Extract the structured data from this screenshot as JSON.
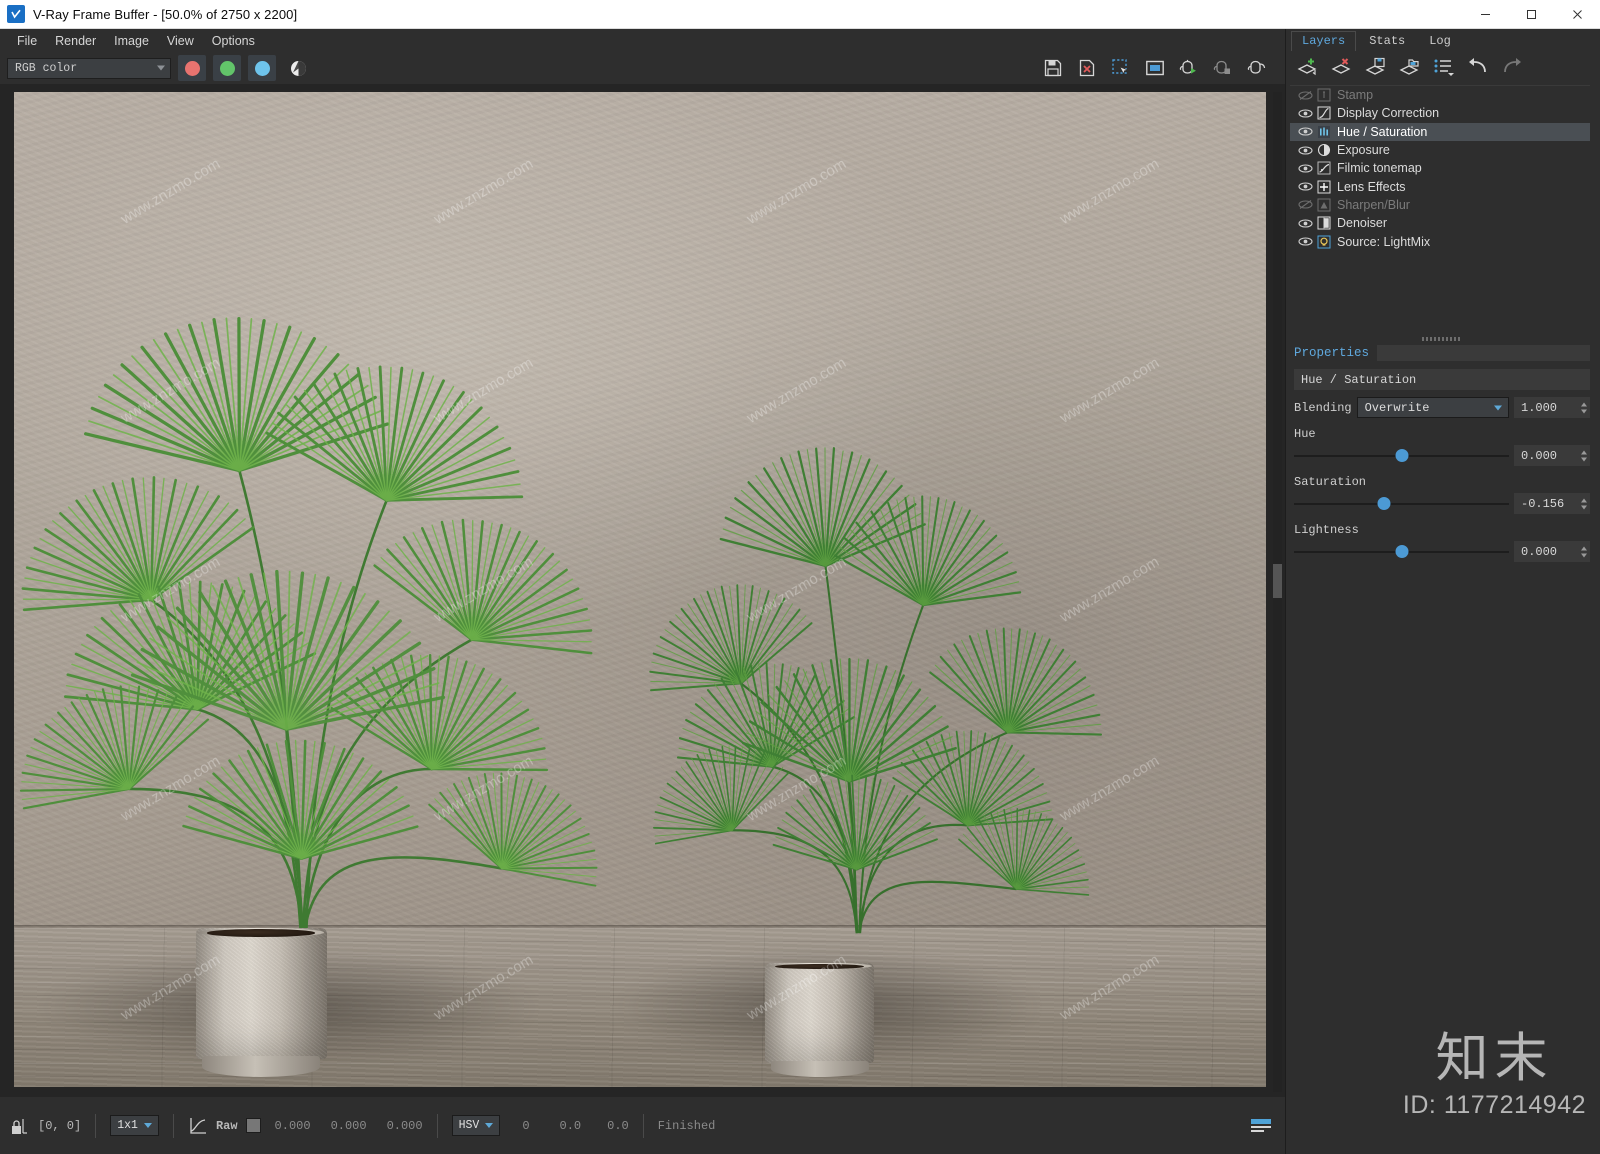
{
  "window": {
    "title": "V-Ray Frame Buffer - [50.0% of 2750 x 2200]",
    "icon": "vray-logo-icon",
    "minimize_label": "—",
    "maximize_label": "□",
    "close_label": "✕"
  },
  "menu": {
    "items": [
      {
        "label": "File"
      },
      {
        "label": "Render"
      },
      {
        "label": "Image"
      },
      {
        "label": "View"
      },
      {
        "label": "Options"
      }
    ]
  },
  "toolbar": {
    "channel_select": {
      "value": "RGB color",
      "icon": "chevron-down-icon"
    },
    "color_buttons": [
      {
        "name": "red-channel-button",
        "color": "#e8736f"
      },
      {
        "name": "green-channel-button",
        "color": "#62c46a"
      },
      {
        "name": "blue-channel-button",
        "color": "#6ec4ec"
      }
    ],
    "alpha_button": {
      "name": "alpha-channel-button",
      "color": "#e9e9e9"
    },
    "right_tools": [
      {
        "name": "save-image-button",
        "icon": "save-icon"
      },
      {
        "name": "clear-image-button",
        "icon": "file-delete-icon"
      },
      {
        "name": "region-render-button",
        "icon": "region-select-icon"
      },
      {
        "name": "fit-to-window-button",
        "icon": "fit-window-icon"
      },
      {
        "name": "start-render-button",
        "icon": "teapot-play-icon"
      },
      {
        "name": "stop-render-button",
        "icon": "teapot-stop-icon"
      },
      {
        "name": "resume-render-button",
        "icon": "teapot-resume-icon"
      }
    ]
  },
  "statusbar": {
    "pixel_lock_icon": "pixel-lock-icon",
    "coords": "[0,  0]",
    "sample_size": {
      "value": "1x1",
      "icon": "chevron-down-icon"
    },
    "curve_icon": "curve-icon",
    "raw_label": "Raw",
    "color_swatch": "#777777",
    "rgb_values": [
      "0.000",
      "0.000",
      "0.000"
    ],
    "color_mode": {
      "value": "HSV",
      "icon": "chevron-down-icon"
    },
    "hsv_values": [
      "0",
      "0.0",
      "0.0"
    ],
    "render_status": "Finished",
    "histogram_icon": "histogram-icon"
  },
  "right_panel": {
    "tabs": [
      {
        "label": "Layers",
        "active": true
      },
      {
        "label": "Stats",
        "active": false
      },
      {
        "label": "Log",
        "active": false
      }
    ],
    "layer_toolbar": [
      {
        "name": "add-layer-button",
        "icon": "layer-add-icon"
      },
      {
        "name": "delete-layer-button",
        "icon": "layer-delete-icon"
      },
      {
        "name": "save-layers-button",
        "icon": "layer-save-icon"
      },
      {
        "name": "load-layers-button",
        "icon": "layer-load-icon"
      },
      {
        "name": "layer-presets-button",
        "icon": "list-menu-icon"
      },
      {
        "name": "undo-button",
        "icon": "undo-icon"
      },
      {
        "name": "redo-button",
        "icon": "redo-icon"
      }
    ],
    "layers": [
      {
        "name": "Stamp",
        "icon": "stamp-icon",
        "visible": false,
        "enabled": false,
        "selected": false
      },
      {
        "name": "Display Correction",
        "icon": "curve-icon",
        "visible": true,
        "enabled": true,
        "selected": false
      },
      {
        "name": "Hue / Saturation",
        "icon": "hue-saturation-icon",
        "visible": true,
        "enabled": true,
        "selected": true
      },
      {
        "name": "Exposure",
        "icon": "exposure-icon",
        "visible": true,
        "enabled": true,
        "selected": false
      },
      {
        "name": "Filmic tonemap",
        "icon": "filmic-tonemap-icon",
        "visible": true,
        "enabled": true,
        "selected": false
      },
      {
        "name": "Lens Effects",
        "icon": "lens-effects-icon",
        "visible": true,
        "enabled": true,
        "selected": false
      },
      {
        "name": "Sharpen/Blur",
        "icon": "sharpen-blur-icon",
        "visible": false,
        "enabled": false,
        "selected": false
      },
      {
        "name": "Denoiser",
        "icon": "denoiser-icon",
        "visible": true,
        "enabled": true,
        "selected": false
      },
      {
        "name": "Source: LightMix",
        "icon": "lightmix-icon",
        "visible": true,
        "enabled": true,
        "selected": false
      }
    ],
    "properties": {
      "title": "Properties",
      "layer_name": "Hue / Saturation",
      "blending": {
        "label": "Blending",
        "value": "Overwrite",
        "amount": "1.000"
      },
      "sliders": [
        {
          "label": "Hue",
          "value": "0.000",
          "position_pct": 50
        },
        {
          "label": "Saturation",
          "value": "-0.156",
          "position_pct": 42
        },
        {
          "label": "Lightness",
          "value": "0.000",
          "position_pct": 50
        }
      ]
    }
  },
  "watermarks": {
    "logo": "知末",
    "id": "ID: 1177214942",
    "tile_text": "www.znzmo.com"
  },
  "render_scene": {
    "description": "Interior render of two fan palm plants in concrete pots on a wood plank floor against a plaster wall",
    "accent_color": "#5fa8dd"
  }
}
